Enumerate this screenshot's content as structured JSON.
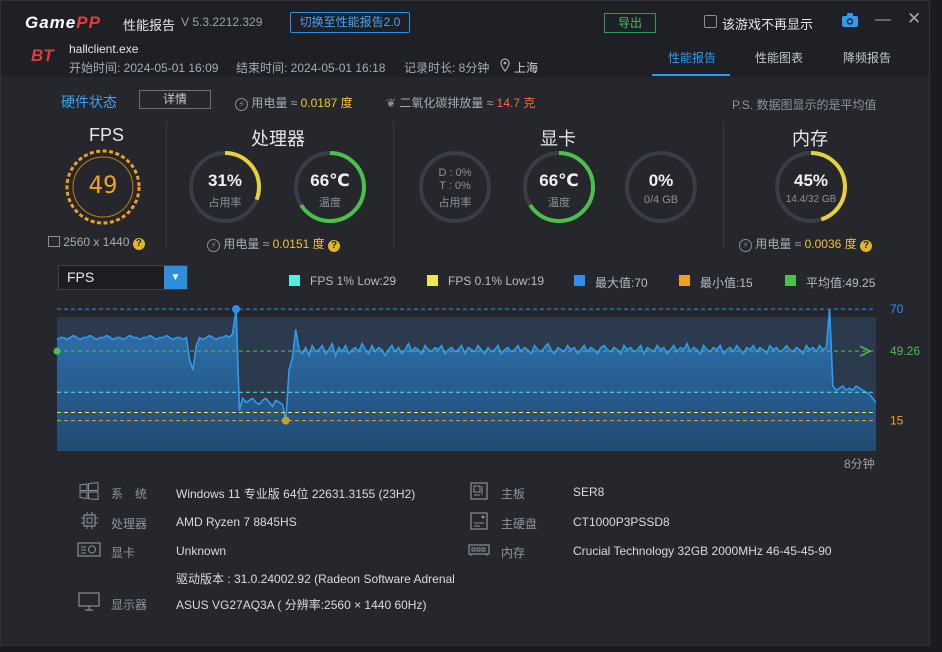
{
  "titlebar": {
    "logo": "GamePP",
    "title": "性能报告",
    "version": "V 5.3.2212.329",
    "switch_label": "切换至性能报告2.0",
    "export_label": "导出",
    "hide_label": "该游戏不再显示"
  },
  "session": {
    "app_name": "hallclient.exe",
    "start": "开始时间: 2024-05-01 16:09",
    "end": "结束时间: 2024-05-01 16:18",
    "duration": "记录时长: 8分钟",
    "location": "上海"
  },
  "tabs": [
    "性能报告",
    "性能图表",
    "降频报告"
  ],
  "hardware": {
    "title": "硬件状态",
    "detail_label": "详情",
    "power_prefix": "用电量 ≈",
    "power_value": "0.0187 度",
    "co2_prefix": "二氧化碳排放量 ≈",
    "co2_value": "14.7 克",
    "note": "P.S. 数据图显示的是平均值"
  },
  "sections": {
    "fps": {
      "title": "FPS",
      "value": "49",
      "resolution": "2560 x 1440"
    },
    "cpu": {
      "title": "处理器",
      "usage": "31%",
      "usage_label": "占用率",
      "usage_level": 0.31,
      "temp": "66℃",
      "temp_label": "温度",
      "temp_level": 0.66,
      "power_prefix": "用电量 ≈",
      "power_value": "0.0151 度"
    },
    "gpu": {
      "title": "显卡",
      "d_line": "D : 0%",
      "t_line": "T : 0%",
      "usage_label": "占用率",
      "temp": "66℃",
      "temp_label": "温度",
      "temp_level": 0.66,
      "mem": "0%",
      "mem_sub": "0/4 GB"
    },
    "memory": {
      "title": "内存",
      "usage": "45%",
      "usage_sub": "14.4/32 GB",
      "usage_level": 0.45,
      "power_prefix": "用电量 ≈",
      "power_value": "0.0036 度"
    }
  },
  "chart_select": "FPS",
  "chart_data": {
    "type": "area",
    "legend": [
      {
        "label": "FPS 1% Low:29",
        "color": "#4ef0e0"
      },
      {
        "label": "FPS 0.1% Low:19",
        "color": "#f0e84a"
      },
      {
        "label": "最大值:70",
        "color": "#2e8ff0"
      },
      {
        "label": "最小值:15",
        "color": "#f0a020"
      },
      {
        "label": "平均值:49.25",
        "color": "#4cc04a"
      }
    ],
    "max": 70,
    "min": 15,
    "avg_marker": "49.26",
    "low1": 29,
    "low01": 19,
    "ylim": [
      0,
      75
    ],
    "x_end_label": "8分钟",
    "x_range": [
      0,
      8
    ],
    "values": [
      55,
      56,
      56,
      55,
      56,
      57,
      56,
      55,
      56,
      56,
      57,
      56,
      55,
      56,
      56,
      57,
      56,
      55,
      56,
      56,
      55,
      56,
      57,
      56,
      56,
      55,
      56,
      56,
      57,
      56,
      55,
      56,
      56,
      57,
      56,
      55,
      56,
      56,
      55,
      56,
      45,
      40,
      52,
      56,
      55,
      56,
      57,
      56,
      55,
      56,
      56,
      57,
      56,
      58,
      70,
      20,
      26,
      24,
      25,
      26,
      24,
      23,
      25,
      26,
      24,
      22,
      25,
      24,
      23,
      15,
      40,
      46,
      60,
      50,
      48,
      51,
      47,
      52,
      49,
      50,
      52,
      48,
      50,
      53,
      47,
      51,
      49,
      52,
      48,
      50,
      51,
      49,
      53,
      50,
      48,
      52,
      49,
      51,
      50,
      47,
      50,
      52,
      49,
      51,
      48,
      50,
      53,
      49,
      51,
      50,
      48,
      52,
      50,
      49,
      51,
      50,
      52,
      48,
      50,
      51,
      49,
      50,
      52,
      48,
      51,
      50,
      49,
      52,
      50,
      48,
      51,
      49,
      50,
      52,
      48,
      50,
      51,
      49,
      50,
      52,
      49,
      51,
      50,
      48,
      52,
      50,
      49,
      51,
      53,
      50,
      48,
      51,
      50,
      49,
      52,
      50,
      51,
      48,
      50,
      52,
      49,
      51,
      50,
      48,
      51,
      52,
      50,
      49,
      51,
      50,
      48,
      52,
      50,
      51,
      49,
      50,
      52,
      48,
      51,
      50,
      49,
      52,
      50,
      51,
      48,
      50,
      52,
      49,
      51,
      50,
      53,
      49,
      51,
      50,
      48,
      52,
      50,
      49,
      51,
      50,
      52,
      48,
      50,
      51,
      49,
      52,
      50,
      48,
      51,
      50,
      52,
      49,
      51,
      50,
      48,
      52,
      50,
      51,
      49,
      50,
      52,
      50,
      49,
      51,
      50,
      48,
      52,
      50,
      51,
      49,
      52,
      50,
      51,
      70,
      32,
      30,
      31,
      32,
      30,
      31,
      30,
      32,
      31,
      30,
      29,
      28,
      26,
      24
    ]
  },
  "sysinfo": {
    "os_label": "系　统",
    "os_value": "Windows 11 专业版 64位 22631.3155 (23H2)",
    "cpu_label": "处理器",
    "cpu_value": "AMD Ryzen 7 8845HS",
    "gpu_label": "显卡",
    "gpu_value": "Unknown",
    "driver_value": "驱动版本 : 31.0.24002.92 (Radeon Software Adrenal",
    "display_label": "显示器",
    "display_value": "ASUS VG27AQ3A ( 分辨率:2560 × 1440 60Hz)",
    "board_label": "主板",
    "board_value": "SER8",
    "disk_label": "主硬盘",
    "disk_value": "CT1000P3PSSD8",
    "mem_label": "内存",
    "mem_value": "Crucial Technology 32GB 2000MHz 46-45-45-90"
  },
  "colors": {
    "accent": "#2e9bf0",
    "fps_ring": "#f0a020",
    "ring_track": "#3a3d45",
    "ring_green": "#4cc04a",
    "ring_yellow": "#e5d13a"
  }
}
